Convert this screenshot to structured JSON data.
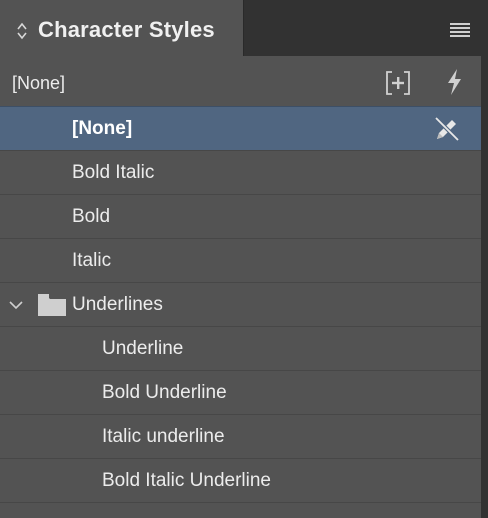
{
  "panel": {
    "tab_title": "Character Styles",
    "current_style": "[None]"
  },
  "styles": [
    {
      "label": "[None]",
      "selected": true
    },
    {
      "label": "Bold Italic"
    },
    {
      "label": "Bold"
    },
    {
      "label": "Italic"
    }
  ],
  "group": {
    "label": "Underlines",
    "expanded": true,
    "items": [
      {
        "label": "Underline"
      },
      {
        "label": "Bold Underline"
      },
      {
        "label": "Italic underline"
      },
      {
        "label": "Bold Italic Underline"
      }
    ]
  },
  "icons": {
    "tab": "up-down-arrows-icon",
    "menu": "panel-menu-icon",
    "new_style": "new-style-icon",
    "quick_apply": "lightning-icon",
    "edit_lock": "pencil-slash-icon",
    "group_toggle": "chevron-down-icon",
    "group": "folder-icon"
  },
  "colors": {
    "panel_bg": "#535353",
    "selection": "#506681",
    "text": "#ececec"
  }
}
